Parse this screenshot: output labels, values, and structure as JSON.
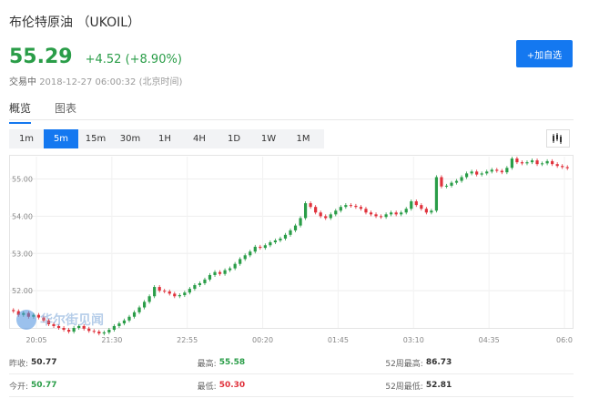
{
  "header": {
    "title": "布伦特原油 （UKOIL）",
    "price": "55.29",
    "change": "+4.52 (+8.90%)",
    "status": "交易中",
    "timestamp": "2018-12-27 06:00:32 (北京时间)",
    "add_watchlist": "+加自选"
  },
  "tabs": [
    {
      "label": "概览",
      "active": true
    },
    {
      "label": "图表",
      "active": false
    }
  ],
  "intervals": [
    {
      "label": "1m",
      "active": false
    },
    {
      "label": "5m",
      "active": true
    },
    {
      "label": "15m",
      "active": false
    },
    {
      "label": "30m",
      "active": false
    },
    {
      "label": "1H",
      "active": false
    },
    {
      "label": "4H",
      "active": false
    },
    {
      "label": "1D",
      "active": false
    },
    {
      "label": "1W",
      "active": false
    },
    {
      "label": "1M",
      "active": false
    }
  ],
  "watermark": "华尔街见闻",
  "colors": {
    "up": "#2a9d48",
    "down": "#e0323c",
    "accent": "#1478f0"
  },
  "chart_data": {
    "type": "candlestick",
    "x_tick_labels": [
      "20:05",
      "21:30",
      "22:55",
      "00:20",
      "01:45",
      "03:10",
      "04:35",
      "06:0"
    ],
    "y_tick_labels": [
      "52.00",
      "53.00",
      "54.00",
      "55.00"
    ],
    "ylim": [
      51.0,
      55.6
    ],
    "grid": true,
    "closes": [
      51.45,
      51.35,
      51.4,
      51.3,
      51.35,
      51.28,
      51.2,
      51.1,
      51.05,
      51.0,
      50.95,
      50.9,
      51.0,
      51.05,
      50.98,
      50.92,
      50.9,
      50.85,
      50.88,
      50.95,
      51.05,
      51.12,
      51.2,
      51.3,
      51.42,
      51.55,
      51.7,
      51.85,
      52.1,
      52.0,
      51.98,
      51.92,
      51.85,
      51.88,
      51.95,
      52.05,
      52.15,
      52.2,
      52.3,
      52.42,
      52.5,
      52.45,
      52.55,
      52.6,
      52.72,
      52.85,
      52.95,
      53.05,
      53.18,
      53.15,
      53.22,
      53.3,
      53.35,
      53.4,
      53.5,
      53.62,
      53.75,
      53.95,
      54.35,
      54.25,
      54.1,
      54.0,
      53.95,
      54.05,
      54.15,
      54.25,
      54.3,
      54.28,
      54.25,
      54.2,
      54.1,
      54.05,
      54.0,
      53.98,
      54.05,
      54.1,
      54.05,
      54.1,
      54.2,
      54.4,
      54.3,
      54.2,
      54.1,
      54.15,
      55.05,
      54.8,
      54.82,
      54.9,
      54.95,
      55.05,
      55.15,
      55.2,
      55.12,
      55.15,
      55.2,
      55.25,
      55.22,
      55.18,
      55.3,
      55.55,
      55.45,
      55.42,
      55.45,
      55.5,
      55.4,
      55.42,
      55.48,
      55.4,
      55.35,
      55.32,
      55.29
    ]
  },
  "stats": [
    [
      {
        "label": "昨收:",
        "value": "50.77",
        "tone": "plain"
      },
      {
        "label": "最高:",
        "value": "55.58",
        "tone": "green"
      },
      {
        "label": "52周最高:",
        "value": "86.73",
        "tone": "plain"
      }
    ],
    [
      {
        "label": "今开:",
        "value": "50.77",
        "tone": "green"
      },
      {
        "label": "最低:",
        "value": "50.30",
        "tone": "red"
      },
      {
        "label": "52周最低:",
        "value": "52.81",
        "tone": "plain"
      }
    ]
  ]
}
